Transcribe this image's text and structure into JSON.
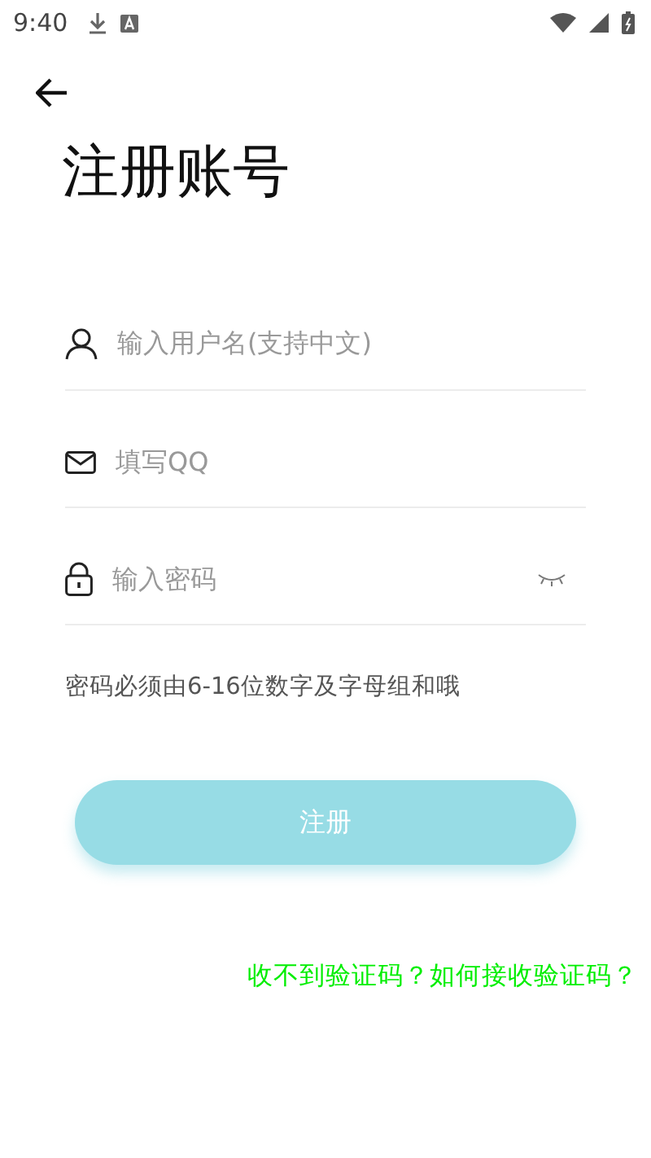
{
  "status_bar": {
    "time": "9:40"
  },
  "title": "注册账号",
  "fields": [
    {
      "kind": "user",
      "placeholder": "输入用户名(支持中文)"
    },
    {
      "kind": "mail",
      "placeholder": "填写QQ"
    },
    {
      "kind": "lock",
      "placeholder": "输入密码",
      "password_visible": false
    }
  ],
  "hint": "密码必须由6-16位数字及字母组和哦",
  "submit_button": {
    "label": "注册"
  },
  "help_link": "收不到验证码？如何接收验证码？"
}
